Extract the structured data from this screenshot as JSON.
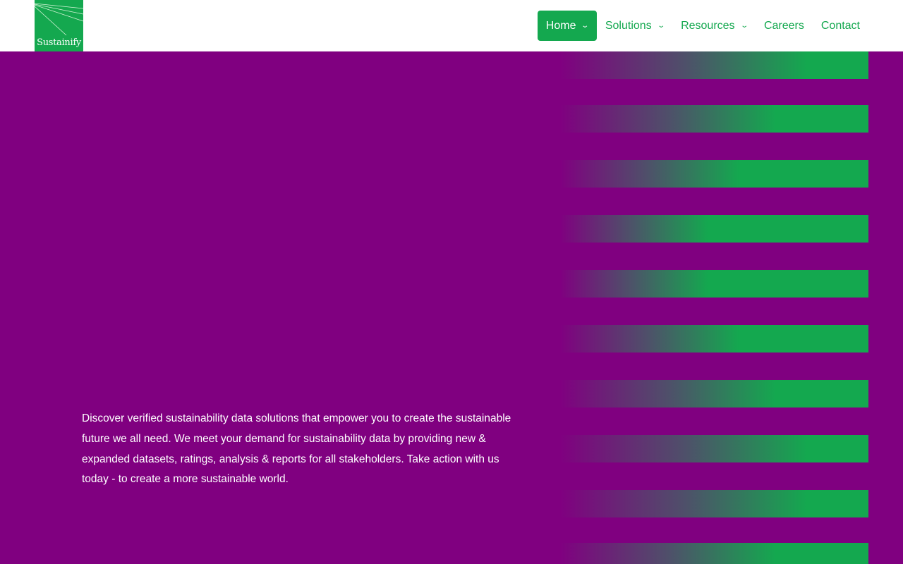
{
  "logo": {
    "text": "Sustainify"
  },
  "nav": {
    "items": [
      {
        "label": "Home",
        "dropdown": true
      },
      {
        "label": "Solutions",
        "dropdown": true
      },
      {
        "label": "Resources",
        "dropdown": true
      },
      {
        "label": "Careers",
        "dropdown": false
      },
      {
        "label": "Contact",
        "dropdown": false
      }
    ]
  },
  "hero": {
    "description": "Discover verified sustainability data solutions that empower you to create the sustainable future we all need. We meet your demand for sustainability data by providing new & expanded datasets, ratings, analysis & reports for all stakeholders. Take action with us today - to create a more sustainable world."
  },
  "colors": {
    "brand": "#14a84f",
    "background": "#800080"
  }
}
